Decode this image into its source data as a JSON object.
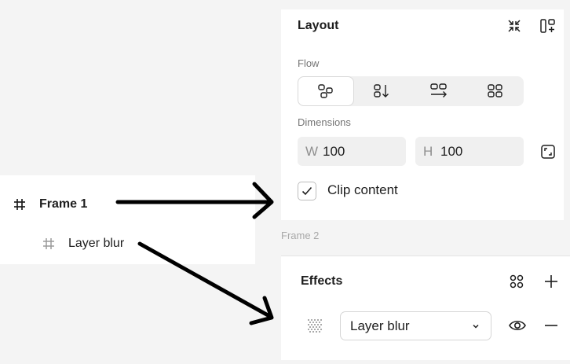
{
  "layers": {
    "frame_icon": "hash-icon",
    "frame_name": "Frame 1",
    "child_icon": "hash-icon",
    "child_name": "Layer blur"
  },
  "layout": {
    "title": "Layout",
    "flow_label": "Flow",
    "flow_options": [
      "freeform-icon",
      "vertical-icon",
      "horizontal-icon",
      "grid-icon"
    ],
    "active_flow": 0,
    "dimensions_label": "Dimensions",
    "width_label": "W",
    "width_value": "100",
    "height_label": "H",
    "height_value": "100",
    "clip_content_label": "Clip content",
    "clip_content_checked": true
  },
  "frame2_label": "Frame 2",
  "effects": {
    "title": "Effects",
    "effect_type": "Layer blur"
  },
  "colors": {
    "background": "#f4f4f4",
    "panel": "#ffffff",
    "field": "#f0f0f0",
    "text": "#1e1e1e",
    "muted": "#757575",
    "arrow": "#000000"
  }
}
